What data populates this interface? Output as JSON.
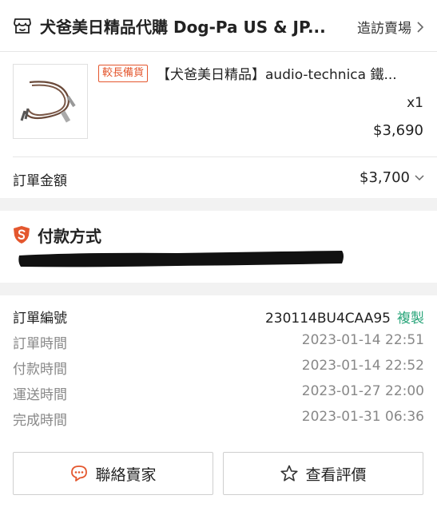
{
  "shop": {
    "name": "犬爸美日精品代購 Dog-Pa US & JP...",
    "visit_label": "造訪賣場"
  },
  "product": {
    "badge": "較長備貨",
    "title": "【犬爸美日精品】audio-technica 鐵...",
    "quantity": "x1",
    "price": "$3,690"
  },
  "order_total": {
    "label": "訂單金額",
    "value": "$3,700"
  },
  "payment": {
    "title": "付款方式"
  },
  "order_info": {
    "order_number_label": "訂單編號",
    "order_number": "230114BU4CAA95",
    "copy_label": "複製",
    "rows": [
      {
        "label": "訂單時間",
        "value": "2023-01-14 22:51"
      },
      {
        "label": "付款時間",
        "value": "2023-01-14 22:52"
      },
      {
        "label": "運送時間",
        "value": "2023-01-27 22:00"
      },
      {
        "label": "完成時間",
        "value": "2023-01-31 06:36"
      }
    ]
  },
  "actions": {
    "contact_label": "聯絡賣家",
    "review_label": "查看評價"
  },
  "colors": {
    "accent": "#e4572e",
    "copy_link": "#2aa57a",
    "muted_text": "#888888"
  },
  "icons": {
    "store": "store-icon",
    "chevron_right": "chevron-right-icon",
    "chevron_down": "chevron-down-icon",
    "shield": "shield-icon",
    "chat": "chat-icon",
    "star": "star-icon"
  }
}
